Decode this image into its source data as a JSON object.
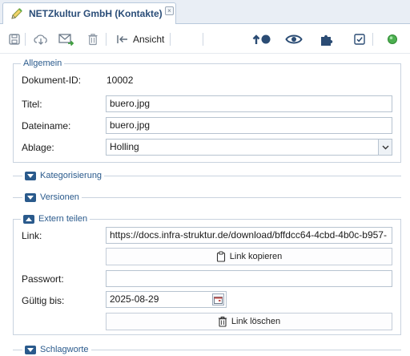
{
  "tab": {
    "title": "NETZkultur GmbH (Kontakte)",
    "close_glyph": "×",
    "icon": "pencil-icon"
  },
  "toolbar": {
    "view_label": "Ansicht",
    "icons": [
      "save-icon",
      "download-icon",
      "mail-forward-icon",
      "trash-icon",
      "back-view-icon",
      "priority-icon",
      "eye-icon",
      "puzzle-icon",
      "checkbox-icon",
      "status-dot-icon"
    ],
    "status_color": "#4caf50"
  },
  "allgemein": {
    "legend": "Allgemein",
    "doc_id_label": "Dokument-ID:",
    "doc_id_value": "10002",
    "title_label": "Titel:",
    "title_value": "buero.jpg",
    "filename_label": "Dateiname:",
    "filename_value": "buero.jpg",
    "storage_label": "Ablage:",
    "storage_value": "Holling"
  },
  "sections": {
    "categorization": "Kategorisierung",
    "versions": "Versionen",
    "keywords": "Schlagworte"
  },
  "share": {
    "legend": "Extern teilen",
    "link_label": "Link:",
    "link_value": "https://docs.infra-struktur.de/download/bffdcc64-4cbd-4b0c-b957-",
    "copy_label": "Link kopieren",
    "password_label": "Passwort:",
    "password_value": "",
    "valid_label": "Gültig bis:",
    "valid_value": "2025-08-29",
    "delete_label": "Link löschen"
  },
  "colors": {
    "accent": "#2a5a8c",
    "border": "#c9d3df"
  }
}
